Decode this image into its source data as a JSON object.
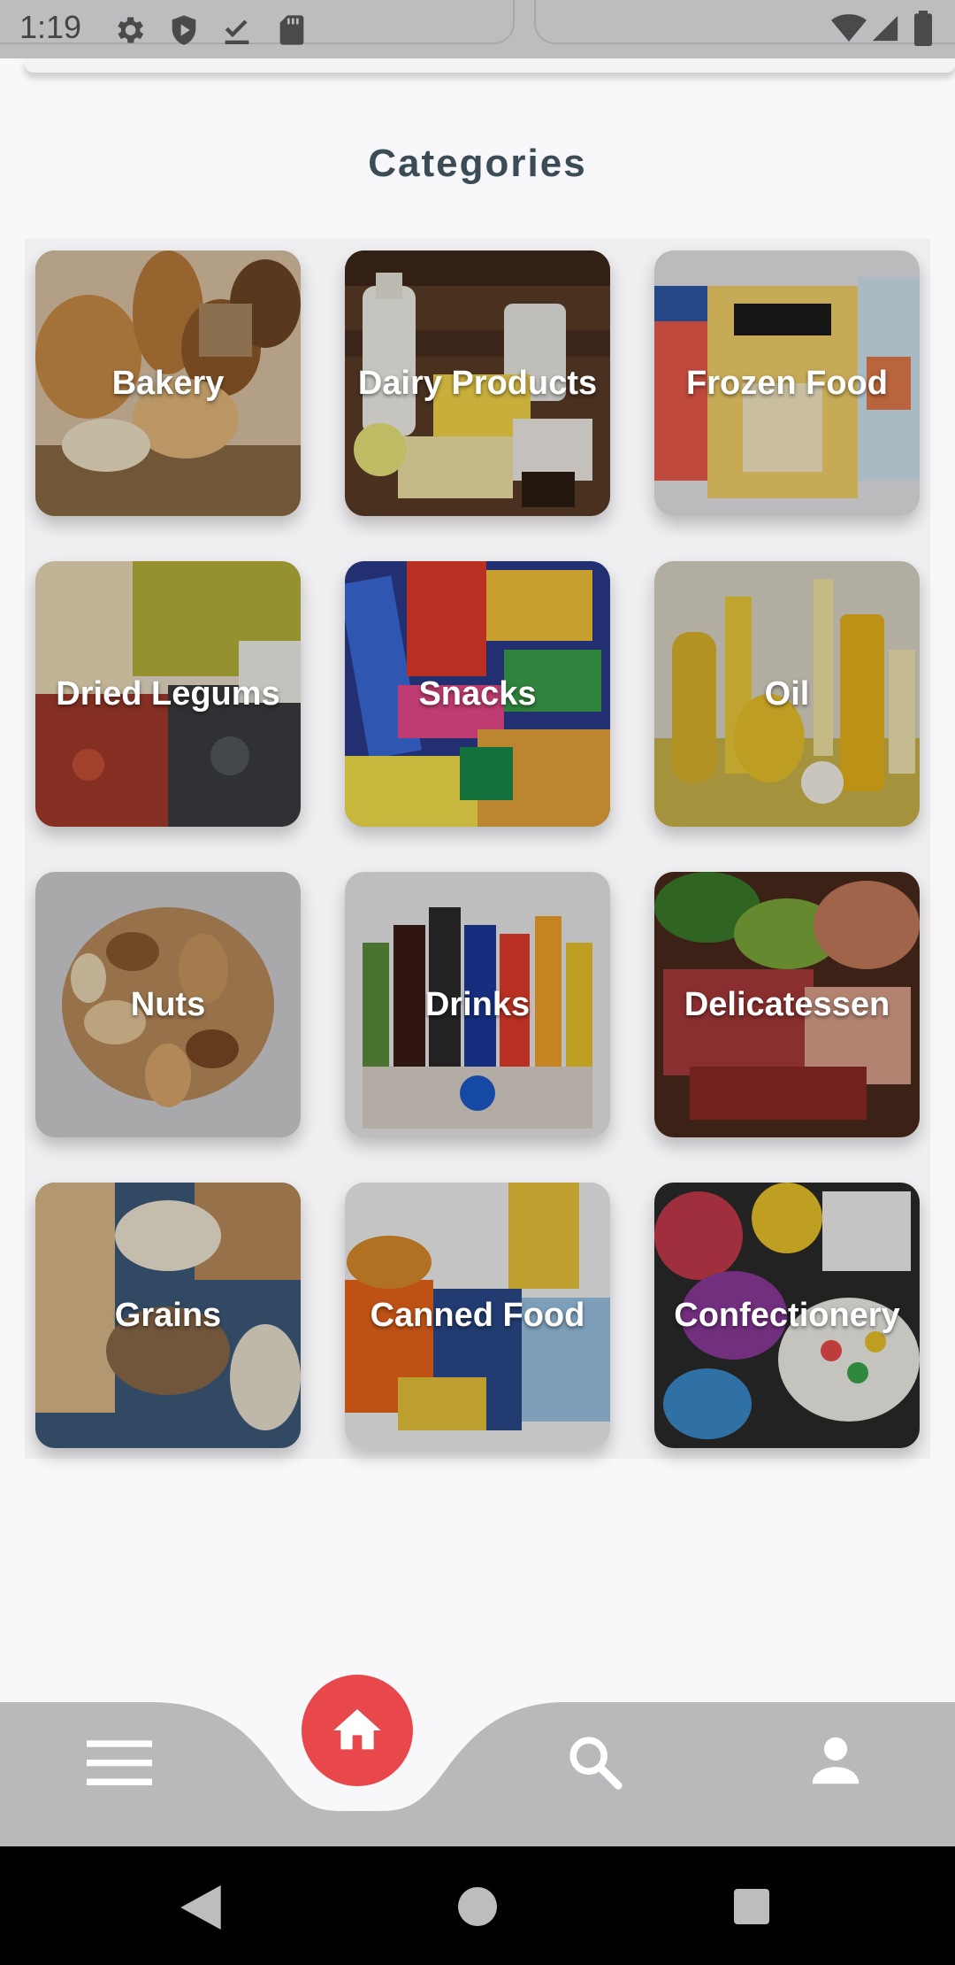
{
  "status_bar": {
    "time": "1:19",
    "icons": [
      "gear-icon",
      "shield-icon",
      "check-download-icon",
      "sd-card-icon"
    ],
    "right_icons": [
      "wifi-icon",
      "signal-icon",
      "battery-icon"
    ]
  },
  "page": {
    "title": "Categories"
  },
  "categories": [
    {
      "label": "Bakery",
      "icon": "bread-image"
    },
    {
      "label": "Dairy Products",
      "icon": "dairy-image"
    },
    {
      "label": "Frozen Food",
      "icon": "frozen-food-image"
    },
    {
      "label": "Dried Legums",
      "icon": "legumes-image"
    },
    {
      "label": "Snacks",
      "icon": "snacks-image"
    },
    {
      "label": "Oil",
      "icon": "oil-image"
    },
    {
      "label": "Nuts",
      "icon": "nuts-image"
    },
    {
      "label": "Drinks",
      "icon": "drinks-image"
    },
    {
      "label": "Delicatessen",
      "icon": "delicatessen-image"
    },
    {
      "label": "Grains",
      "icon": "grains-image"
    },
    {
      "label": "Canned Food",
      "icon": "canned-food-image"
    },
    {
      "label": "Confectionery",
      "icon": "confectionery-image"
    }
  ],
  "bottom_nav": {
    "items": [
      "menu-icon",
      "home-icon",
      "search-icon",
      "profile-icon"
    ],
    "accent_color": "#e8474b",
    "active": "home"
  },
  "system_nav": {
    "items": [
      "back-icon",
      "home-circle-icon",
      "recents-icon"
    ]
  }
}
